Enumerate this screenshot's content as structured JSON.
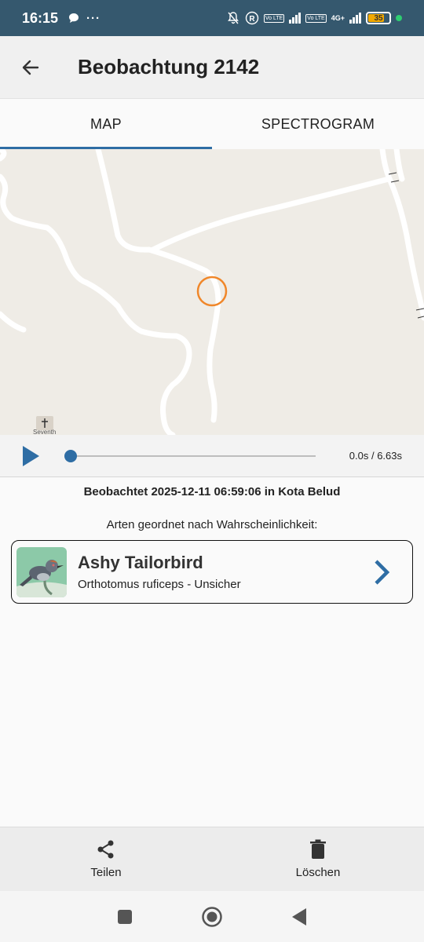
{
  "status_bar": {
    "time": "16:15",
    "battery": "35",
    "network": "4G+",
    "volte": "Vo LTE",
    "icons": [
      "chat-bubble-icon",
      "more-dots-icon",
      "mute-bell-icon",
      "registered-icon",
      "signal-icon",
      "battery-icon"
    ]
  },
  "app_bar": {
    "title": "Beobachtung 2142",
    "back_icon": "arrow-back-icon"
  },
  "tabs": [
    {
      "label": "MAP",
      "active": true
    },
    {
      "label": "SPECTROGRAM",
      "active": false
    }
  ],
  "map": {
    "place_label": "Seventh",
    "marker_color": "#f0872a"
  },
  "player": {
    "time": "0.0s / 6.63s",
    "progress": 0,
    "accent": "#2e6da4"
  },
  "observation": {
    "observed_text": "Beobachtet 2025-12-11 06:59:06 in Kota Belud",
    "ordered_heading": "Arten geordnet nach Wahrscheinlichkeit:"
  },
  "species": [
    {
      "common_name": "Ashy Tailorbird",
      "detail": "Orthotomus ruficeps - Unsicher"
    }
  ],
  "bottom_bar": {
    "share_label": "Teilen",
    "delete_label": "Löschen"
  }
}
